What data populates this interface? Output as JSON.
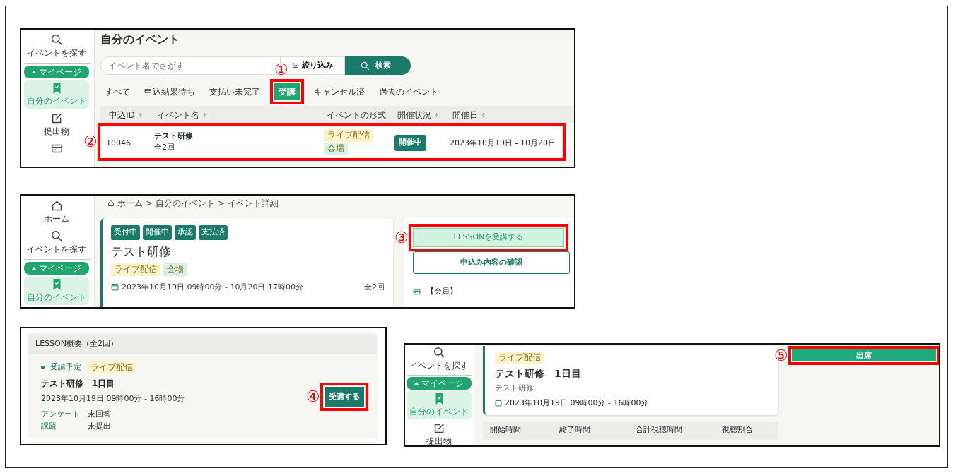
{
  "screens": [
    {
      "kind": "event_list",
      "sidebar": [
        {
          "kind": "search",
          "label": "イベントを探す",
          "selected": false
        },
        {
          "kind": "section",
          "label": "マイページ"
        },
        {
          "kind": "bookmark",
          "label": "自分のイベント",
          "selected": true
        },
        {
          "kind": "edit",
          "label": "提出物",
          "selected": false
        },
        {
          "kind": "card",
          "selected": false
        }
      ],
      "title": "自分のイベント",
      "search": {
        "placeholder": "イベント名でさがす"
      },
      "filter_button": "絞り込み",
      "search_button": "検索",
      "tabs": [
        {
          "label": "すべて",
          "selected": false
        },
        {
          "label": "申込結果待ち",
          "selected": false
        },
        {
          "label": "支払い未完了",
          "selected": false
        },
        {
          "label": "受講",
          "selected": true,
          "step": "①"
        },
        {
          "label": "キャンセル済",
          "selected": false
        },
        {
          "label": "過去のイベント",
          "selected": false
        }
      ],
      "table": {
        "columns": [
          {
            "label": "申込ID",
            "sortable": true
          },
          {
            "label": "イベント名",
            "sortable": true
          },
          {
            "label": "イベントの形式",
            "sortable": false
          },
          {
            "label": "開催状況",
            "sortable": true
          },
          {
            "label": "開催日",
            "sortable": true
          }
        ],
        "rows": [
          {
            "id": "10046",
            "name": "テスト研修",
            "sessions": "全2回",
            "tags": [
              {
                "label": "ライブ配信",
                "color": "#fdf2c9"
              },
              {
                "label": "会場",
                "color": "#d5f2e3"
              }
            ],
            "status": "開催中",
            "dates": "2023年10月19日 - 10月20日",
            "step": "②"
          }
        ]
      }
    },
    {
      "kind": "event_detail",
      "sidebar": [
        {
          "kind": "home",
          "label": "ホーム",
          "selected": false
        },
        {
          "kind": "search",
          "label": "イベントを探す",
          "selected": false
        },
        {
          "kind": "section",
          "label": "マイページ"
        },
        {
          "kind": "bookmark",
          "label": "自分のイベント",
          "selected": true
        }
      ],
      "breadcrumb": {
        "separator": ">",
        "items": [
          "ホーム",
          "自分のイベント",
          "イベント詳細"
        ]
      },
      "badges": [
        "受付中",
        "開催中",
        "承認",
        "支払済"
      ],
      "title": "テスト研修",
      "tags": [
        {
          "label": "ライブ配信",
          "color": "#fdf2c9"
        },
        {
          "label": "会場",
          "color": "#d5f2e3"
        }
      ],
      "date": "2023年10月19日 09時00分 - 10月20日 17時00分",
      "sessions": "全2回",
      "primary_button": {
        "label": "LESSONを受講する",
        "step": "③"
      },
      "secondary_button": "申込み内容の確認",
      "price_label": "【会員】"
    },
    {
      "kind": "lesson_summary",
      "header": "LESSON概要（全2回）",
      "lesson": {
        "status": {
          "label": "受講予定",
          "color": "#1b7a6a"
        },
        "tags": [
          {
            "label": "ライブ配信",
            "color": "#fdf2c9"
          }
        ],
        "title": "テスト研修　1日目",
        "date": "2023年10月19日 09時00分 - 16時00分",
        "meta": [
          {
            "key": "アンケート",
            "value": "未回答"
          },
          {
            "key": "課題",
            "value": "未提出"
          }
        ],
        "button": {
          "label": "受講する",
          "step": "④"
        }
      }
    },
    {
      "kind": "lesson_detail",
      "sidebar": [
        {
          "kind": "search",
          "label": "イベントを探す",
          "selected": false
        },
        {
          "kind": "section",
          "label": "マイページ"
        },
        {
          "kind": "bookmark",
          "label": "自分のイベント",
          "selected": true
        },
        {
          "kind": "edit",
          "label": "提出物",
          "selected": false
        }
      ],
      "tags": [
        {
          "label": "ライブ配信",
          "color": "#fdf2c9"
        }
      ],
      "title": "テスト研修　1日目",
      "subtitle": "テスト研修",
      "date": "2023年10月19日 09時00分 - 16時00分",
      "columns": [
        "開始時間",
        "終了時間",
        "合計視聴時間",
        "視聴割合"
      ],
      "attend_button": {
        "label": "出席",
        "step": "⑤"
      }
    }
  ]
}
